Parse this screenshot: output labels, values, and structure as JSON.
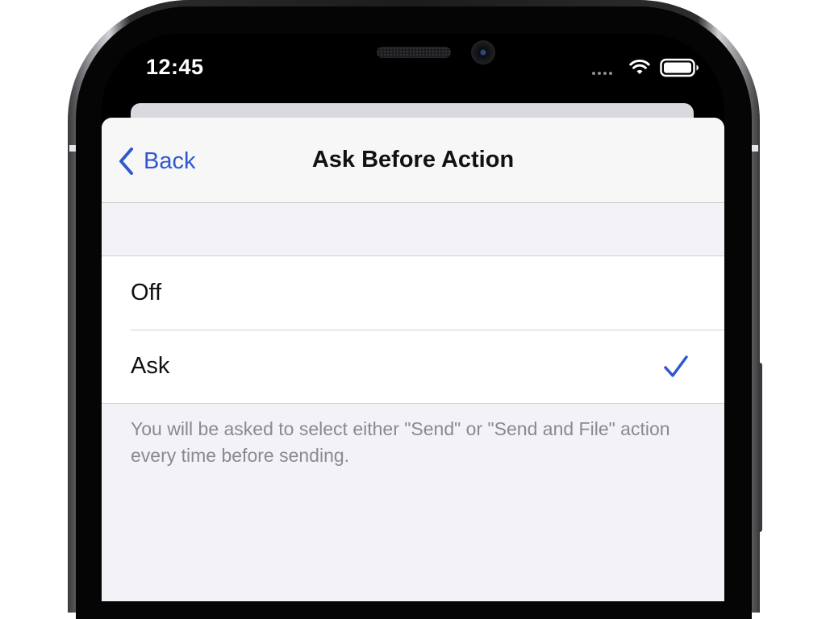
{
  "status_bar": {
    "time": "12:45",
    "wifi_icon": "wifi-icon",
    "battery_icon": "battery-icon"
  },
  "nav": {
    "back_label": "Back",
    "back_icon": "chevron-left-icon",
    "title": "Ask Before Action"
  },
  "options": [
    {
      "label": "Off",
      "selected": false
    },
    {
      "label": "Ask",
      "selected": true
    }
  ],
  "footer_note": "You will be asked to select either \"Send\" or \"Send and File\" action every time before sending.",
  "colors": {
    "accent": "#2f58cf",
    "background": "#f2f2f7",
    "secondary_text": "#8a8a8e"
  }
}
